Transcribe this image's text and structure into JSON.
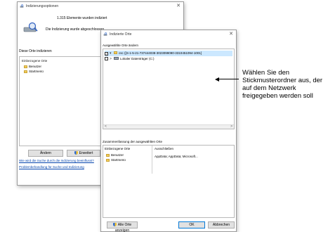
{
  "bg_window": {
    "title": "Indizierungsoptionen",
    "status_count": "1.315 Elemente wurden indiziert",
    "status_done": "Die Indizierung wurde abgeschlossen.",
    "index_label": "Diese Orte indizieren",
    "panel_header": "Einbezogene Orte",
    "folders": [
      "Benutzer",
      "Startmenü"
    ],
    "buttons": {
      "change": "Ändern",
      "advanced": "Erweitert"
    },
    "links": [
      "Wie wird die Suche durch die Indizierung beeinflusst?",
      "Problembehandlung für Suche und Indizierung"
    ]
  },
  "fg_window": {
    "title": "Indizierte Orte",
    "selected_label": "Ausgewählte Orte ändern",
    "tree_items": [
      {
        "label": "csc ([S-1-5-21-737444038-3023099090-3310451094-1001]",
        "checked": true,
        "expand": "▾"
      },
      {
        "label": "Lokaler Datenträger (C:)",
        "checked": false,
        "expand": ">"
      }
    ],
    "summary_label": "Zusammenfassung der ausgewählten Orte",
    "summary": {
      "col1_header": "Einbezogene Orte",
      "col1_items": [
        "Benutzer",
        "Startmenü"
      ],
      "col2_header": "Ausschließen",
      "col2_value": "AppData; AppData; Microsoft..."
    },
    "buttons": {
      "show_all": "Alle Orte anzeigen",
      "ok": "OK",
      "cancel": "Abbrechen"
    }
  },
  "callout": {
    "text": "Wählen Sie den Stickmusterordner aus, der auf dem Netzwerk freigegeben werden soll"
  },
  "colors": {
    "folder": "#f3cd5a",
    "link": "#0645ad",
    "selection": "#cce8ff"
  }
}
